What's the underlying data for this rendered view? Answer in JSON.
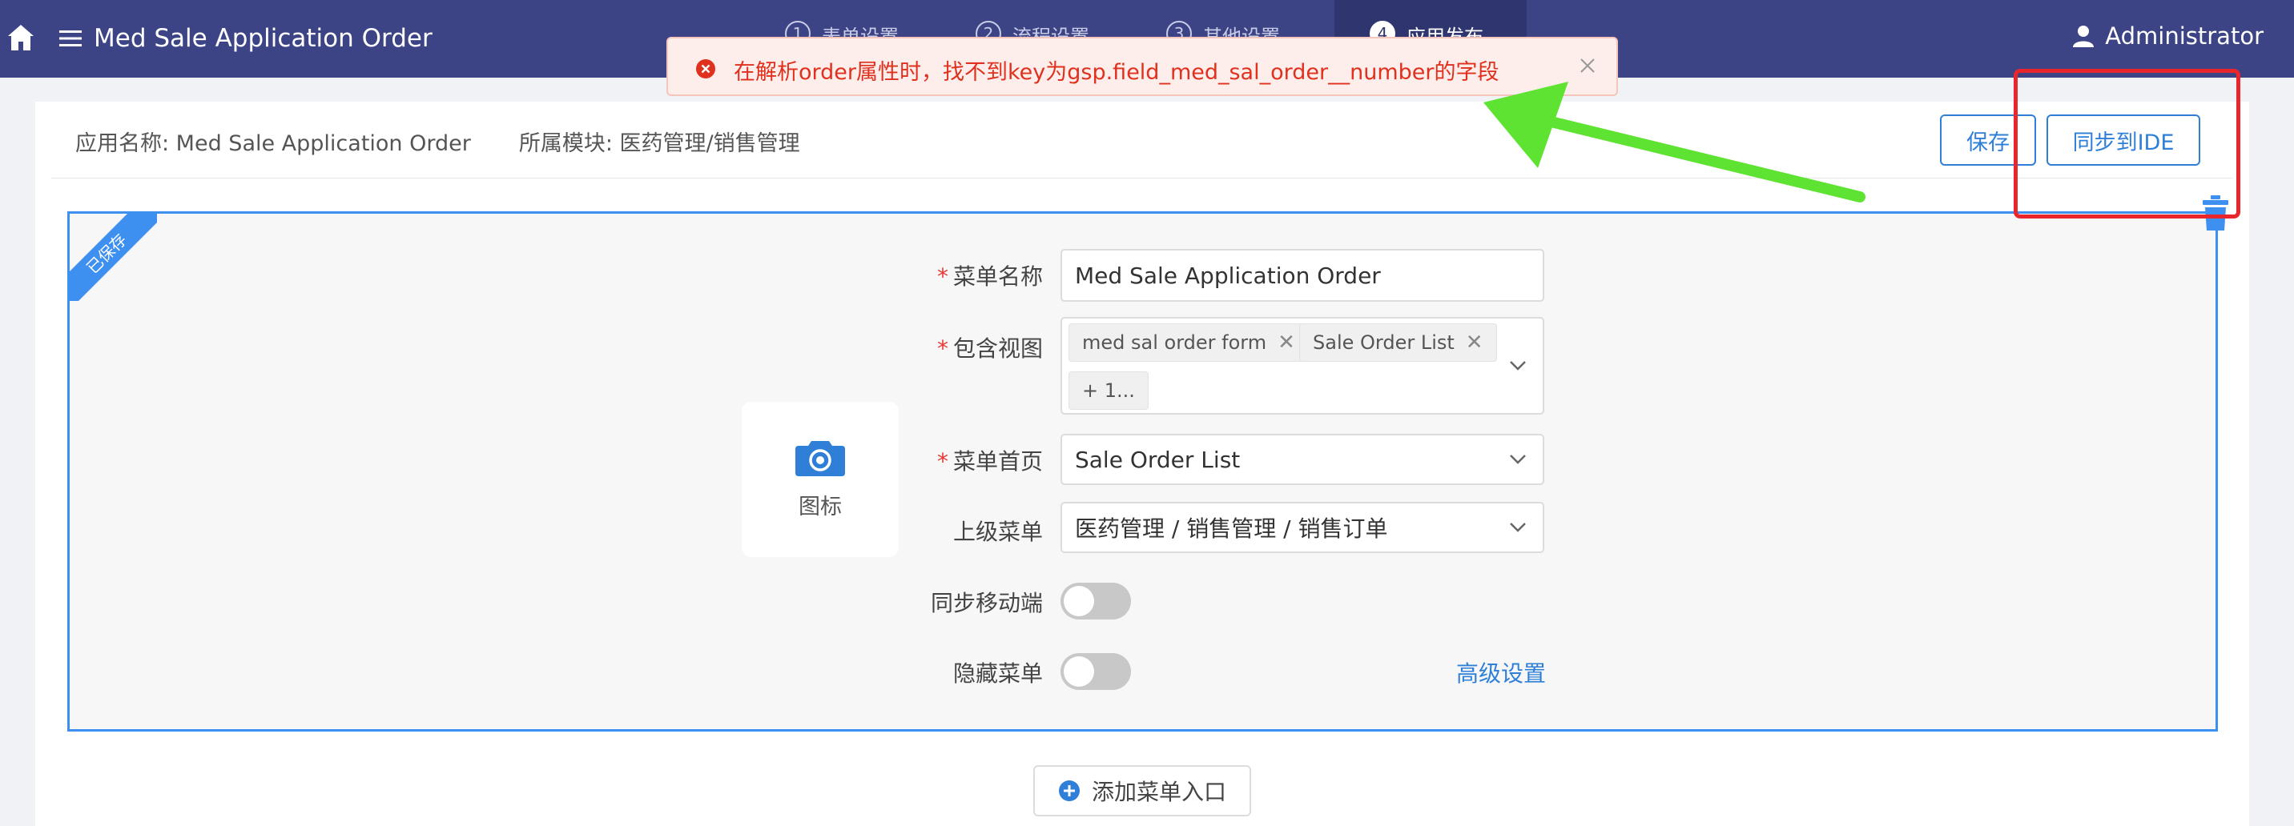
{
  "header": {
    "title": "Med Sale Application Order",
    "steps": [
      {
        "num": "1",
        "label": "表单设置"
      },
      {
        "num": "2",
        "label": "流程设置"
      },
      {
        "num": "3",
        "label": "其他设置"
      },
      {
        "num": "4",
        "label": "应用发布"
      }
    ],
    "user": "Administrator"
  },
  "toast": {
    "message": "在解析order属性时，找不到key为gsp.field_med_sal_order__number的字段"
  },
  "info": {
    "app_name": "应用名称: Med Sale Application Order",
    "module": "所属模块: 医药管理/销售管理"
  },
  "toolbar": {
    "save_label": "保存",
    "sync_label": "同步到IDE"
  },
  "panel": {
    "ribbon": "已保存",
    "icon_label": "图标",
    "menu_name_label": "菜单名称",
    "menu_name_value": "Med Sale Application Order",
    "views_label": "包含视图",
    "views_tags": [
      "med sal order form",
      "Sale Order List"
    ],
    "views_more": "+ 1...",
    "home_label": "菜单首页",
    "home_value": "Sale Order List",
    "parent_label": "上级菜单",
    "parent_value": "医药管理 / 销售管理 / 销售订单",
    "sync_mobile_label": "同步移动端",
    "sync_mobile_on": false,
    "hide_menu_label": "隐藏菜单",
    "hide_menu_on": false,
    "advanced_link": "高级设置"
  },
  "add_entry_label": "添加菜单入口",
  "colors": {
    "header_bg": "#3c4486",
    "primary": "#2f7fd8",
    "error": "#e0301e",
    "annotation_red": "#e8262b",
    "annotation_green": "#5ee332"
  }
}
